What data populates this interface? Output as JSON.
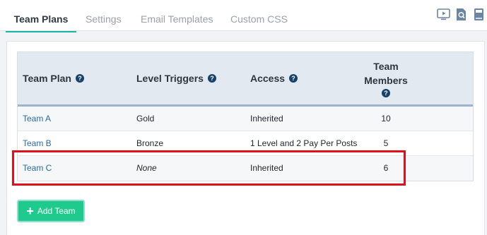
{
  "tabs": [
    {
      "label": "Team Plans",
      "active": true
    },
    {
      "label": "Settings",
      "active": false
    },
    {
      "label": "Email Templates",
      "active": false
    },
    {
      "label": "Custom CSS",
      "active": false
    }
  ],
  "top_icons": [
    "video-icon",
    "search-doc-icon",
    "book-icon"
  ],
  "table": {
    "headers": [
      "Team Plan",
      "Level Triggers",
      "Access",
      "Team Members"
    ],
    "help_glyph": "?",
    "rows": [
      {
        "plan": "Team A",
        "trigger": "Gold",
        "access": "Inherited",
        "members": "10"
      },
      {
        "plan": "Team B",
        "trigger": "Bronze",
        "access": "1 Level and 2 Pay Per Posts",
        "members": "5"
      },
      {
        "plan": "Team C",
        "trigger": "None",
        "access": "Inherited",
        "members": "6"
      }
    ]
  },
  "add_button": {
    "label": "Add Team",
    "icon": "plus-icon"
  },
  "colors": {
    "accent": "#19b3a4",
    "link": "#2b6aa3",
    "button": "#1ecb8c",
    "highlight": "#e0101b",
    "header_bg": "#e3e9f0"
  }
}
